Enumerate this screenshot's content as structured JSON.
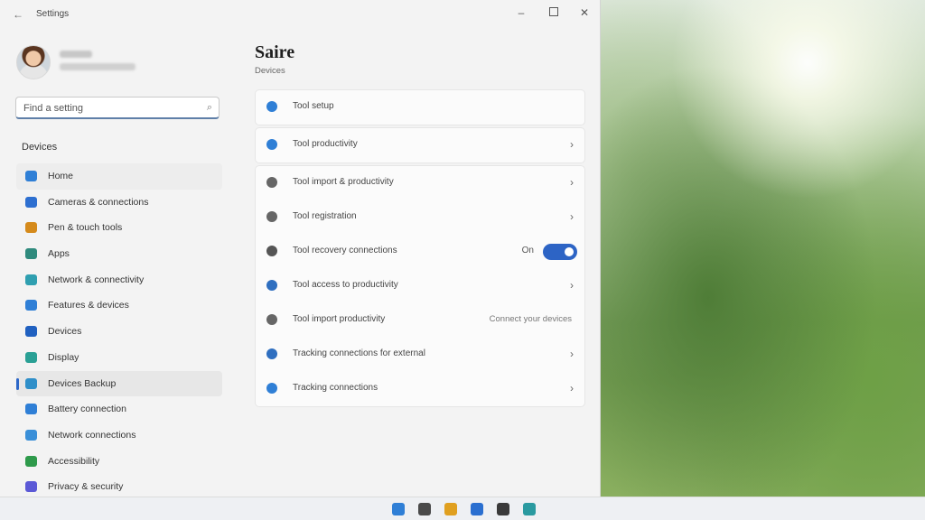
{
  "window": {
    "title": "Settings",
    "controls": {
      "minimize": "–",
      "maximize": "",
      "close": "✕"
    },
    "back": "←"
  },
  "search": {
    "placeholder": "Find a setting",
    "icon": "search-icon"
  },
  "sidebar": {
    "section": "Devices",
    "items": [
      {
        "label": "Home",
        "icon": "home-icon",
        "color": "#2f7fd6"
      },
      {
        "label": "Cameras & connections",
        "icon": "device-icon",
        "color": "#2d6fd0"
      },
      {
        "label": "Pen & touch tools",
        "icon": "pen-icon",
        "color": "#d58a1b"
      },
      {
        "label": "Apps",
        "icon": "apps-icon",
        "color": "#2f8a7d"
      },
      {
        "label": "Network & connectivity",
        "icon": "network-icon",
        "color": "#2f9fb0"
      },
      {
        "label": "Features & devices",
        "icon": "features-icon",
        "color": "#2f7fd6"
      },
      {
        "label": "Devices",
        "icon": "devices-icon",
        "color": "#2060c0"
      },
      {
        "label": "Display",
        "icon": "display-icon",
        "color": "#2aa095"
      },
      {
        "label": "Devices Backup",
        "icon": "backup-icon",
        "color": "#2f8fc9"
      },
      {
        "label": "Battery connection",
        "icon": "battery-icon",
        "color": "#2f7fd6"
      },
      {
        "label": "Network connections",
        "icon": "connections-icon",
        "color": "#3a8fd8"
      },
      {
        "label": "Accessibility",
        "icon": "accessibility-icon",
        "color": "#2e9a4b"
      },
      {
        "label": "Privacy & security",
        "icon": "privacy-icon",
        "color": "#5b59d6"
      }
    ]
  },
  "main": {
    "title": "Saire",
    "subtitle": "Devices",
    "cards": [
      {
        "rows": [
          {
            "label": "Tool setup",
            "icon": "info-icon",
            "color": "#2f7fd6",
            "chevron": ""
          }
        ]
      },
      {
        "rows": [
          {
            "label": "Tool productivity",
            "icon": "gear-icon",
            "color": "#2f7fd6",
            "chevron": "›"
          }
        ]
      },
      {
        "rows": [
          {
            "label": "Tool import & productivity",
            "icon": "clock-icon",
            "color": "#666666",
            "chevron": "›"
          },
          {
            "label": "Tool registration",
            "icon": "history-icon",
            "color": "#666666",
            "chevron": "›"
          },
          {
            "label": "Tool recovery connections",
            "icon": "grid-icon",
            "color": "#555555",
            "chevron": "",
            "toggle": {
              "text": "On",
              "state": "on"
            }
          },
          {
            "label": "Tool access to productivity",
            "icon": "tiles-icon",
            "color": "#2f6fc0",
            "chevron": "›"
          },
          {
            "label": "Tool import productivity",
            "icon": "sparkle-icon",
            "color": "#666666",
            "chevron": "",
            "extra": "Connect your devices"
          },
          {
            "label": "Tracking connections for external",
            "icon": "pen-icon",
            "color": "#2f6fc0",
            "chevron": "›"
          },
          {
            "label": "Tracking connections",
            "icon": "globe-icon",
            "color": "#2f7fd6",
            "chevron": "›"
          }
        ]
      }
    ]
  },
  "taskbar": {
    "icons": [
      {
        "name": "start-icon",
        "color": "#2f7fd6"
      },
      {
        "name": "chat-icon",
        "color": "#4a4a4a"
      },
      {
        "name": "widgets-icon",
        "color": "#e0a020"
      },
      {
        "name": "store-icon",
        "color": "#2a6fd0"
      },
      {
        "name": "media-icon",
        "color": "#3a3a3a"
      },
      {
        "name": "settings-app-icon",
        "color": "#2a9aa0"
      }
    ]
  }
}
